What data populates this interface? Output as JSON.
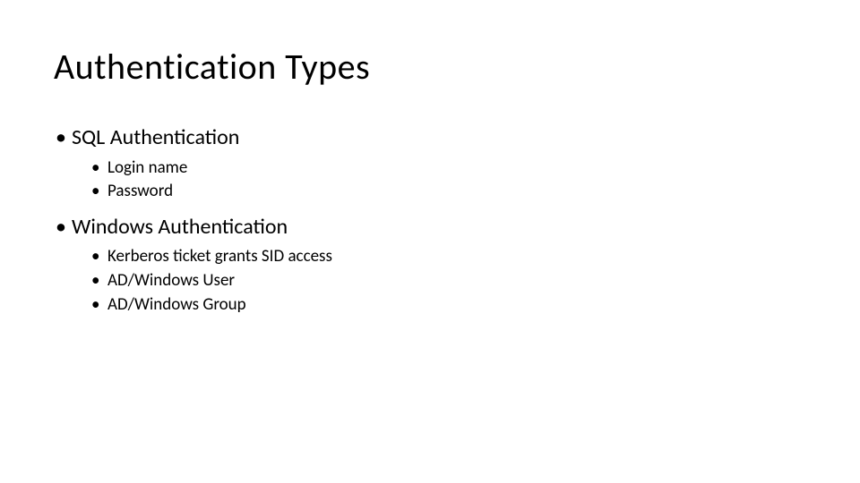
{
  "slide": {
    "title": "Authentication Types",
    "sections": [
      {
        "heading": "SQL Authentication",
        "items": [
          "Login name",
          "Password"
        ]
      },
      {
        "heading": "Windows Authentication",
        "items": [
          "Kerberos ticket grants SID access",
          "AD/Windows User",
          "AD/Windows Group"
        ]
      }
    ]
  }
}
